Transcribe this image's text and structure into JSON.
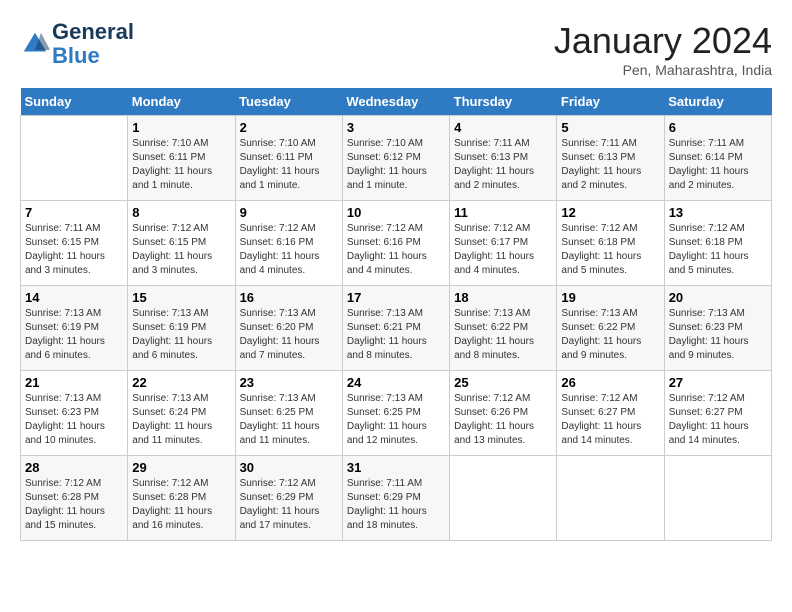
{
  "logo": {
    "line1": "General",
    "line2": "Blue"
  },
  "title": "January 2024",
  "subtitle": "Pen, Maharashtra, India",
  "days_of_week": [
    "Sunday",
    "Monday",
    "Tuesday",
    "Wednesday",
    "Thursday",
    "Friday",
    "Saturday"
  ],
  "weeks": [
    [
      {
        "num": "",
        "info": ""
      },
      {
        "num": "1",
        "info": "Sunrise: 7:10 AM\nSunset: 6:11 PM\nDaylight: 11 hours\nand 1 minute."
      },
      {
        "num": "2",
        "info": "Sunrise: 7:10 AM\nSunset: 6:11 PM\nDaylight: 11 hours\nand 1 minute."
      },
      {
        "num": "3",
        "info": "Sunrise: 7:10 AM\nSunset: 6:12 PM\nDaylight: 11 hours\nand 1 minute."
      },
      {
        "num": "4",
        "info": "Sunrise: 7:11 AM\nSunset: 6:13 PM\nDaylight: 11 hours\nand 2 minutes."
      },
      {
        "num": "5",
        "info": "Sunrise: 7:11 AM\nSunset: 6:13 PM\nDaylight: 11 hours\nand 2 minutes."
      },
      {
        "num": "6",
        "info": "Sunrise: 7:11 AM\nSunset: 6:14 PM\nDaylight: 11 hours\nand 2 minutes."
      }
    ],
    [
      {
        "num": "7",
        "info": "Sunrise: 7:11 AM\nSunset: 6:15 PM\nDaylight: 11 hours\nand 3 minutes."
      },
      {
        "num": "8",
        "info": "Sunrise: 7:12 AM\nSunset: 6:15 PM\nDaylight: 11 hours\nand 3 minutes."
      },
      {
        "num": "9",
        "info": "Sunrise: 7:12 AM\nSunset: 6:16 PM\nDaylight: 11 hours\nand 4 minutes."
      },
      {
        "num": "10",
        "info": "Sunrise: 7:12 AM\nSunset: 6:16 PM\nDaylight: 11 hours\nand 4 minutes."
      },
      {
        "num": "11",
        "info": "Sunrise: 7:12 AM\nSunset: 6:17 PM\nDaylight: 11 hours\nand 4 minutes."
      },
      {
        "num": "12",
        "info": "Sunrise: 7:12 AM\nSunset: 6:18 PM\nDaylight: 11 hours\nand 5 minutes."
      },
      {
        "num": "13",
        "info": "Sunrise: 7:12 AM\nSunset: 6:18 PM\nDaylight: 11 hours\nand 5 minutes."
      }
    ],
    [
      {
        "num": "14",
        "info": "Sunrise: 7:13 AM\nSunset: 6:19 PM\nDaylight: 11 hours\nand 6 minutes."
      },
      {
        "num": "15",
        "info": "Sunrise: 7:13 AM\nSunset: 6:19 PM\nDaylight: 11 hours\nand 6 minutes."
      },
      {
        "num": "16",
        "info": "Sunrise: 7:13 AM\nSunset: 6:20 PM\nDaylight: 11 hours\nand 7 minutes."
      },
      {
        "num": "17",
        "info": "Sunrise: 7:13 AM\nSunset: 6:21 PM\nDaylight: 11 hours\nand 8 minutes."
      },
      {
        "num": "18",
        "info": "Sunrise: 7:13 AM\nSunset: 6:22 PM\nDaylight: 11 hours\nand 8 minutes."
      },
      {
        "num": "19",
        "info": "Sunrise: 7:13 AM\nSunset: 6:22 PM\nDaylight: 11 hours\nand 9 minutes."
      },
      {
        "num": "20",
        "info": "Sunrise: 7:13 AM\nSunset: 6:23 PM\nDaylight: 11 hours\nand 9 minutes."
      }
    ],
    [
      {
        "num": "21",
        "info": "Sunrise: 7:13 AM\nSunset: 6:23 PM\nDaylight: 11 hours\nand 10 minutes."
      },
      {
        "num": "22",
        "info": "Sunrise: 7:13 AM\nSunset: 6:24 PM\nDaylight: 11 hours\nand 11 minutes."
      },
      {
        "num": "23",
        "info": "Sunrise: 7:13 AM\nSunset: 6:25 PM\nDaylight: 11 hours\nand 11 minutes."
      },
      {
        "num": "24",
        "info": "Sunrise: 7:13 AM\nSunset: 6:25 PM\nDaylight: 11 hours\nand 12 minutes."
      },
      {
        "num": "25",
        "info": "Sunrise: 7:12 AM\nSunset: 6:26 PM\nDaylight: 11 hours\nand 13 minutes."
      },
      {
        "num": "26",
        "info": "Sunrise: 7:12 AM\nSunset: 6:27 PM\nDaylight: 11 hours\nand 14 minutes."
      },
      {
        "num": "27",
        "info": "Sunrise: 7:12 AM\nSunset: 6:27 PM\nDaylight: 11 hours\nand 14 minutes."
      }
    ],
    [
      {
        "num": "28",
        "info": "Sunrise: 7:12 AM\nSunset: 6:28 PM\nDaylight: 11 hours\nand 15 minutes."
      },
      {
        "num": "29",
        "info": "Sunrise: 7:12 AM\nSunset: 6:28 PM\nDaylight: 11 hours\nand 16 minutes."
      },
      {
        "num": "30",
        "info": "Sunrise: 7:12 AM\nSunset: 6:29 PM\nDaylight: 11 hours\nand 17 minutes."
      },
      {
        "num": "31",
        "info": "Sunrise: 7:11 AM\nSunset: 6:29 PM\nDaylight: 11 hours\nand 18 minutes."
      },
      {
        "num": "",
        "info": ""
      },
      {
        "num": "",
        "info": ""
      },
      {
        "num": "",
        "info": ""
      }
    ]
  ]
}
